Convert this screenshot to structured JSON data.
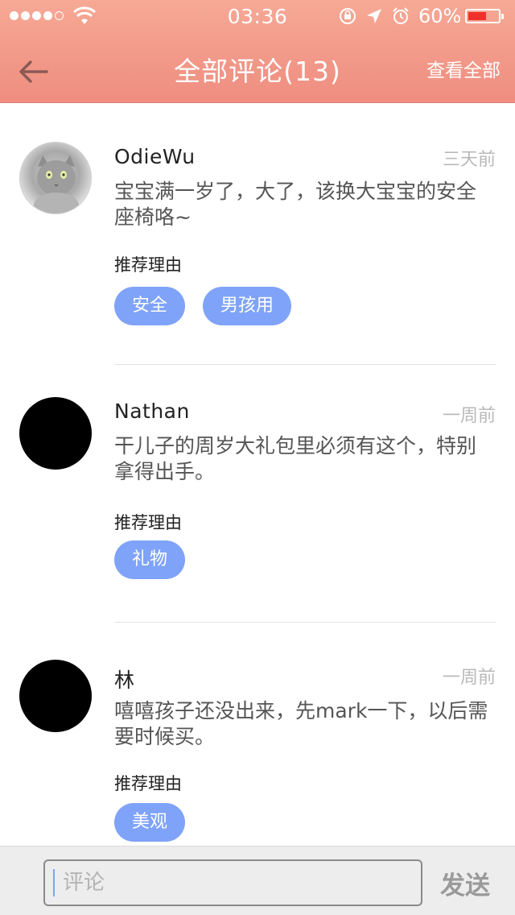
{
  "status_bar": {
    "time": "03:36",
    "battery": "60%",
    "battery_level": 0.6
  },
  "header": {
    "title": "全部评论(13)",
    "view_all": "查看全部"
  },
  "comments": [
    {
      "username": "OdieWu",
      "time_ago": "三天前",
      "text": "宝宝满一岁了，大了，该换大宝宝的安全座椅咯~",
      "reason_label": "推荐理由",
      "tags": [
        "安全",
        "男孩用"
      ]
    },
    {
      "username": "Nathan",
      "time_ago": "一周前",
      "text": "干儿子的周岁大礼包里必须有这个，特别拿得出手。",
      "reason_label": "推荐理由",
      "tags": [
        "礼物"
      ]
    },
    {
      "username": "林",
      "time_ago": "一周前",
      "text": "嘻嘻孩子还没出来，先mark一下，以后需要时候买。",
      "reason_label": "推荐理由",
      "tags": [
        "美观"
      ]
    }
  ],
  "bottom_bar": {
    "input_placeholder": "评论",
    "send_label": "发送"
  }
}
